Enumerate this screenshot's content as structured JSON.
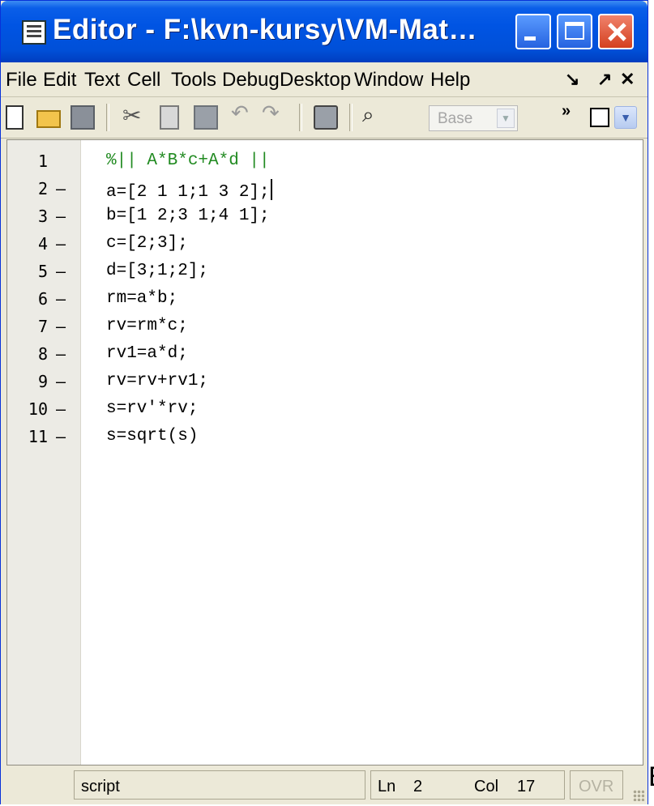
{
  "window": {
    "title": "Editor - F:\\kvn-kursy\\VM-Mat…",
    "controls": {
      "minimize": "minimize",
      "maximize": "maximize",
      "close": "close"
    }
  },
  "menubar": {
    "items": [
      "File",
      "Edit",
      "Text",
      "Cell",
      "Tools",
      "Debug",
      "Desktop",
      "Window",
      "Help"
    ],
    "dock_glyph": "↘",
    "undock_glyph": "↗",
    "close_glyph": "✕"
  },
  "toolbar": {
    "icons": [
      "new-file-icon",
      "open-folder-icon",
      "save-icon",
      "cut-icon",
      "copy-icon",
      "paste-icon",
      "undo-icon",
      "redo-icon",
      "print-icon",
      "find-icon"
    ],
    "stack_select": {
      "value": "Base"
    },
    "overflow_glyph": "»"
  },
  "editor": {
    "lines": [
      {
        "n": "1",
        "marker": "",
        "code": "%|| A*B*c+A*d ||",
        "type": "comment"
      },
      {
        "n": "2",
        "marker": "–",
        "code": "a=[2 1 1;1 3 2];",
        "type": "code"
      },
      {
        "n": "3",
        "marker": "–",
        "code": "b=[1 2;3 1;4 1];",
        "type": "code"
      },
      {
        "n": "4",
        "marker": "–",
        "code": "c=[2;3];",
        "type": "code"
      },
      {
        "n": "5",
        "marker": "–",
        "code": "d=[3;1;2];",
        "type": "code"
      },
      {
        "n": "6",
        "marker": "–",
        "code": "rm=a*b;",
        "type": "code"
      },
      {
        "n": "7",
        "marker": "–",
        "code": "rv=rm*c;",
        "type": "code"
      },
      {
        "n": "8",
        "marker": "–",
        "code": "rv1=a*d;",
        "type": "code"
      },
      {
        "n": "9",
        "marker": "–",
        "code": "rv=rv+rv1;",
        "type": "code"
      },
      {
        "n": "10",
        "marker": "–",
        "code": "s=rv'*rv;",
        "type": "code"
      },
      {
        "n": "11",
        "marker": "–",
        "code": "s=sqrt(s)",
        "type": "code"
      }
    ],
    "colors": {
      "comment": "#228b22",
      "code": "#000000"
    }
  },
  "statusbar": {
    "mode": "script",
    "ln_label": "Ln",
    "ln_value": "2",
    "col_label": "Col",
    "col_value": "17",
    "ovr": "OVR"
  },
  "edge_text": "E"
}
